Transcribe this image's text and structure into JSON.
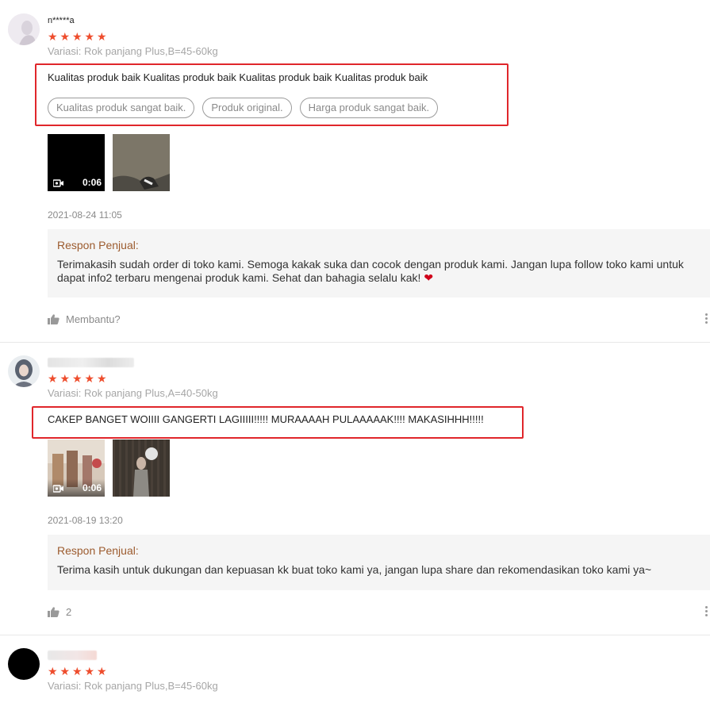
{
  "reviews": [
    {
      "username": "n*****a",
      "rating": 5,
      "variation": "Variasi: Rok panjang Plus,B=45-60kg",
      "comment": "Kualitas produk baik Kualitas produk baik Kualitas produk baik Kualitas produk baik",
      "tags": [
        "Kualitas produk sangat baik.",
        "Produk original.",
        "Harga produk sangat baik."
      ],
      "media": [
        {
          "type": "video",
          "duration": "0:06"
        },
        {
          "type": "image"
        }
      ],
      "timestamp": "2021-08-24 11:05",
      "seller_response": {
        "label": "Respon Penjual:",
        "text": "Terimakasih sudah order di toko kami. Semoga kakak suka dan cocok dengan produk kami. Jangan lupa follow toko kami untuk dapat info2 terbaru mengenai produk kami. Sehat dan bahagia selalu kak!",
        "emoji": "heart-icon"
      },
      "helpful_text": "Membantu?"
    },
    {
      "username": "",
      "rating": 5,
      "variation": "Variasi: Rok panjang Plus,A=40-50kg",
      "comment": "CAKEP BANGET WOIIII GANGERTI LAGIIIII!!!!! MURAAAAH PULAAAAAK!!!! MAKASIHHH!!!!!",
      "media": [
        {
          "type": "video",
          "duration": "0:06"
        },
        {
          "type": "image"
        }
      ],
      "timestamp": "2021-08-19 13:20",
      "seller_response": {
        "label": "Respon Penjual:",
        "text": "Terima kasih untuk dukungan dan kepuasan kk buat toko kami ya, jangan lupa share dan rekomendasikan toko kami ya~"
      },
      "helpful_count": "2"
    },
    {
      "username": "",
      "rating": 5,
      "variation": "Variasi: Rok panjang Plus,B=45-60kg"
    }
  ],
  "colors": {
    "star": "#ee4d2d",
    "highlight_box": "#e0262b",
    "seller_label": "#9c5b2e"
  }
}
